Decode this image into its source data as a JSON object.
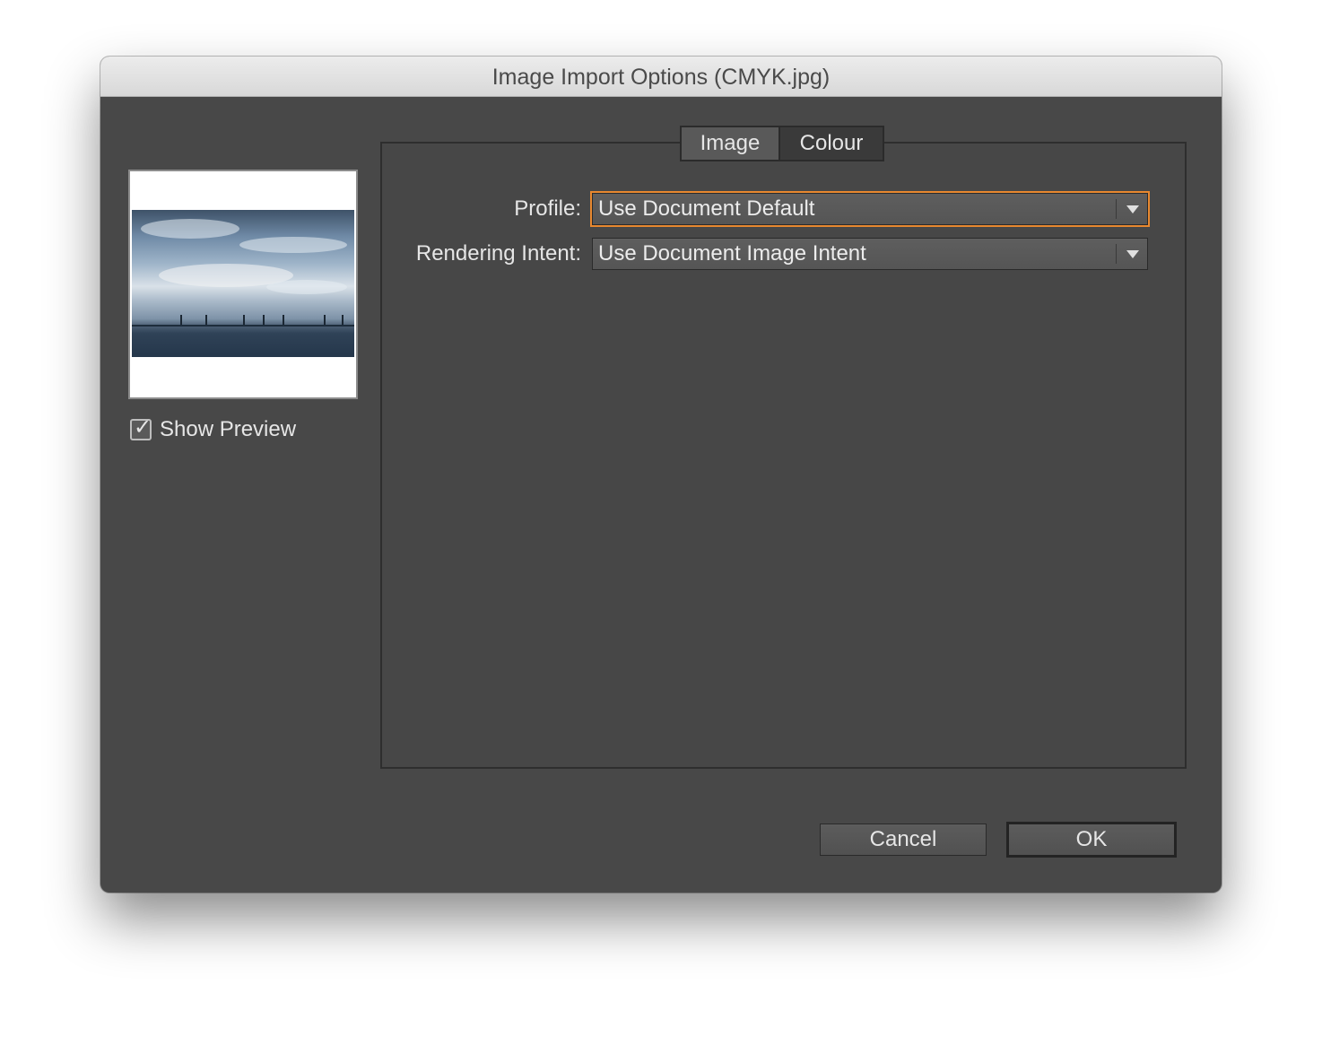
{
  "window": {
    "title": "Image Import Options (CMYK.jpg)"
  },
  "preview": {
    "show_preview_label": "Show Preview",
    "show_preview_checked": true
  },
  "tabs": [
    {
      "label": "Image",
      "selected": false
    },
    {
      "label": "Colour",
      "selected": true
    }
  ],
  "colour_tab": {
    "profile_label": "Profile:",
    "profile_value": "Use Document Default",
    "rendering_intent_label": "Rendering Intent:",
    "rendering_intent_value": "Use Document Image Intent"
  },
  "buttons": {
    "cancel_label": "Cancel",
    "ok_label": "OK"
  },
  "colors": {
    "dialog_bg": "#484848",
    "focus_ring": "#e8882f",
    "text": "#e6e6e6"
  },
  "icons": {
    "checkbox_check": "check-icon",
    "dropdown_arrow": "chevron-down-icon"
  }
}
